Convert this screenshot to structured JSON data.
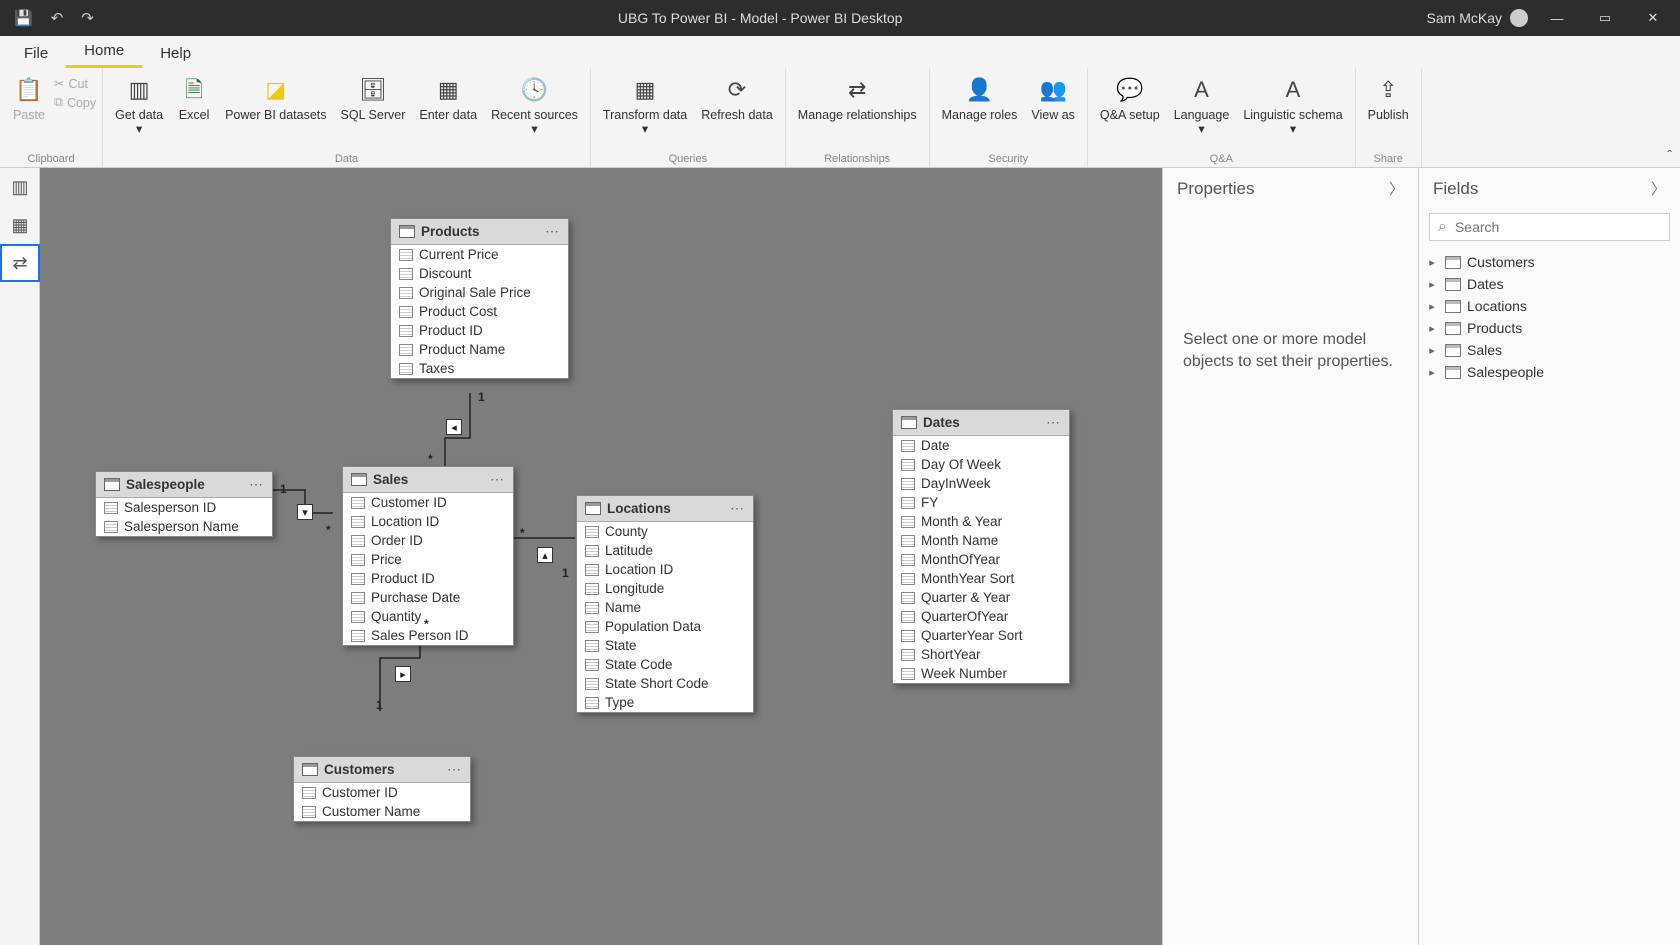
{
  "titlebar": {
    "title": "UBG To Power BI - Model - Power BI Desktop",
    "user": "Sam McKay"
  },
  "menu": {
    "file": "File",
    "home": "Home",
    "help": "Help"
  },
  "ribbon": {
    "paste": "Paste",
    "cut": "Cut",
    "copy": "Copy",
    "get_data": "Get data",
    "excel": "Excel",
    "pbi_ds": "Power BI datasets",
    "sql": "SQL Server",
    "enter": "Enter data",
    "recent": "Recent sources",
    "transform": "Transform data",
    "refresh": "Refresh data",
    "manage_rel": "Manage relationships",
    "manage_roles": "Manage roles",
    "view_as": "View as",
    "qa_setup": "Q&A setup",
    "language": "Language",
    "ling": "Linguistic schema",
    "publish": "Publish",
    "grp_clip": "Clipboard",
    "grp_data": "Data",
    "grp_queries": "Queries",
    "grp_rel": "Relationships",
    "grp_sec": "Security",
    "grp_qa": "Q&A",
    "grp_share": "Share"
  },
  "tables": {
    "products": {
      "name": "Products",
      "fields": [
        "Current Price",
        "Discount",
        "Original Sale Price",
        "Product Cost",
        "Product ID",
        "Product Name",
        "Taxes"
      ]
    },
    "sales": {
      "name": "Sales",
      "fields": [
        "Customer ID",
        "Location ID",
        "Order ID",
        "Price",
        "Product ID",
        "Purchase Date",
        "Quantity",
        "Sales Person ID"
      ]
    },
    "salespeople": {
      "name": "Salespeople",
      "fields": [
        "Salesperson ID",
        "Salesperson Name"
      ]
    },
    "locations": {
      "name": "Locations",
      "fields": [
        "County",
        "Latitude",
        "Location ID",
        "Longitude",
        "Name",
        "Population Data",
        "State",
        "State Code",
        "State Short Code",
        "Type"
      ]
    },
    "dates": {
      "name": "Dates",
      "fields": [
        "Date",
        "Day Of Week",
        "DayInWeek",
        "FY",
        "Month & Year",
        "Month Name",
        "MonthOfYear",
        "MonthYear Sort",
        "Quarter & Year",
        "QuarterOfYear",
        "QuarterYear Sort",
        "ShortYear",
        "Week Number"
      ]
    },
    "customers": {
      "name": "Customers",
      "fields": [
        "Customer ID",
        "Customer Name"
      ]
    }
  },
  "properties": {
    "title": "Properties",
    "msg": "Select one or more model objects to set their properties."
  },
  "fields_panel": {
    "title": "Fields",
    "search_ph": "Search",
    "nodes": [
      "Customers",
      "Dates",
      "Locations",
      "Products",
      "Sales",
      "Salespeople"
    ]
  }
}
